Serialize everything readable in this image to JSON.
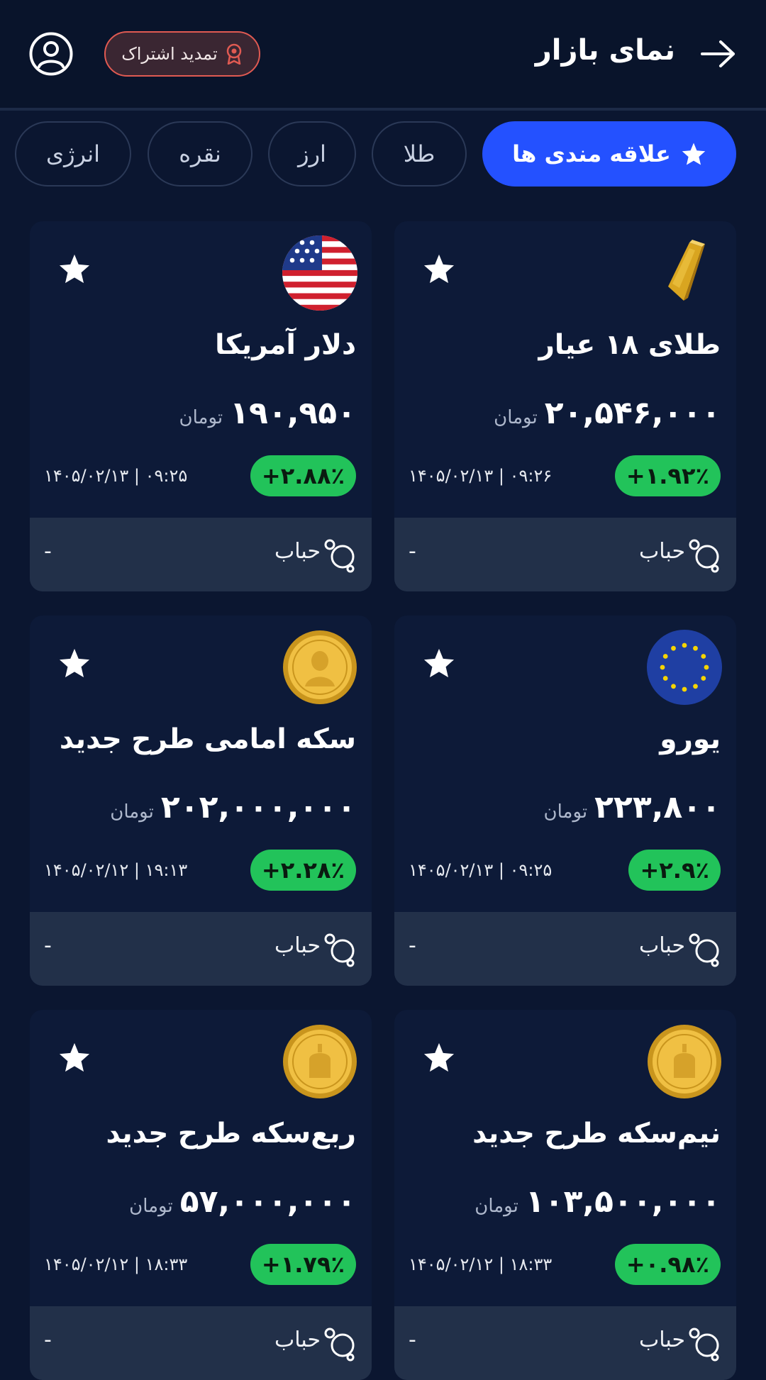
{
  "header": {
    "title": "نمای بازار",
    "renew_label": "تمدید اشتراک"
  },
  "tabs": [
    {
      "label": "علاقه مندی ها",
      "active": true
    },
    {
      "label": "طلا",
      "active": false
    },
    {
      "label": "ارز",
      "active": false
    },
    {
      "label": "نقره",
      "active": false
    },
    {
      "label": "انرژی",
      "active": false
    }
  ],
  "colors": {
    "background": "#0b1630",
    "card": "#0d1a38",
    "card_footer": "#223049",
    "accent": "#2451ff",
    "positive": "#22c35a",
    "renew_border": "#e05a52"
  },
  "cards": [
    {
      "name": "طلای ۱۸ عیار",
      "price": "۲۰,۵۴۶,۰۰۰",
      "unit": "تومان",
      "change": "+۱.۹۲٪",
      "datetime": "۱۴۰۵/۰۲/۱۳ | ۰۹:۲۶",
      "bubble_label": "حباب",
      "bubble_value": "-",
      "icon": "gold-bar-icon"
    },
    {
      "name": "دلار آمریکا",
      "price": "۱۹۰,۹۵۰",
      "unit": "تومان",
      "change": "+۲.۸۸٪",
      "datetime": "۱۴۰۵/۰۲/۱۳ | ۰۹:۲۵",
      "bubble_label": "حباب",
      "bubble_value": "-",
      "icon": "us-flag-icon"
    },
    {
      "name": "یورو",
      "price": "۲۲۳,۸۰۰",
      "unit": "تومان",
      "change": "+۲.۹٪",
      "datetime": "۱۴۰۵/۰۲/۱۳ | ۰۹:۲۵",
      "bubble_label": "حباب",
      "bubble_value": "-",
      "icon": "eu-flag-icon"
    },
    {
      "name": "سکه امامی طرح جدید",
      "price": "۲۰۲,۰۰۰,۰۰۰",
      "unit": "تومان",
      "change": "+۲.۲۸٪",
      "datetime": "۱۴۰۵/۰۲/۱۲ | ۱۹:۱۳",
      "bubble_label": "حباب",
      "bubble_value": "-",
      "icon": "gold-coin-icon"
    },
    {
      "name": "نیم‌سکه طرح جدید",
      "price": "۱۰۳,۵۰۰,۰۰۰",
      "unit": "تومان",
      "change": "+۰.۹۸٪",
      "datetime": "۱۴۰۵/۰۲/۱۲ | ۱۸:۳۳",
      "bubble_label": "حباب",
      "bubble_value": "-",
      "icon": "gold-coin-icon"
    },
    {
      "name": "ربع‌سکه طرح جدید",
      "price": "۵۷,۰۰۰,۰۰۰",
      "unit": "تومان",
      "change": "+۱.۷۹٪",
      "datetime": "۱۴۰۵/۰۲/۱۲ | ۱۸:۳۳",
      "bubble_label": "حباب",
      "bubble_value": "-",
      "icon": "gold-coin-icon"
    }
  ]
}
